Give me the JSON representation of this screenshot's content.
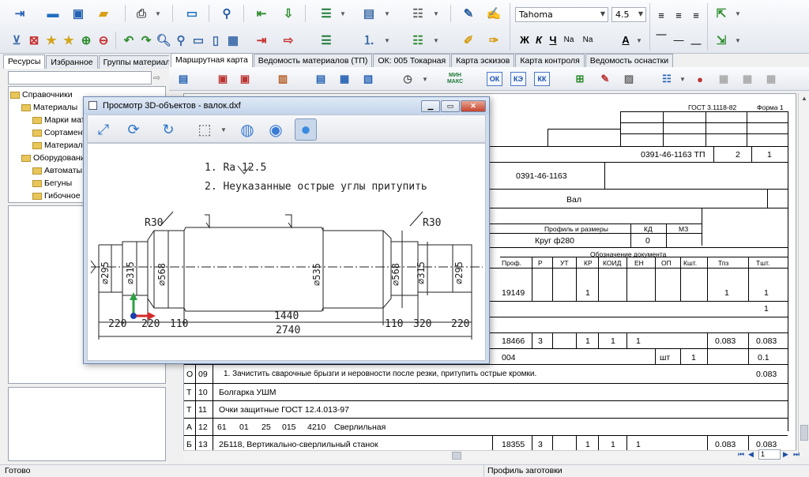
{
  "toolbar": {
    "font_name": "Tahoma",
    "font_size": "4.5",
    "bold": "Ж",
    "italic": "К",
    "underline": "Ч",
    "subscript": "Na",
    "superscript": "Na",
    "text_color_glyph": "A"
  },
  "left_panel": {
    "tabs": [
      "Ресурсы",
      "Избранное",
      "Группы материалов"
    ],
    "search_placeholder": "",
    "tree": [
      {
        "label": "Справочники",
        "level": 0
      },
      {
        "label": "Материалы",
        "level": 1
      },
      {
        "label": "Марки мате",
        "level": 2
      },
      {
        "label": "Сортамент",
        "level": 2
      },
      {
        "label": "Материалы",
        "level": 2
      },
      {
        "label": "Оборудование",
        "level": 1
      },
      {
        "label": "Автоматы",
        "level": 2
      },
      {
        "label": "Бегуны",
        "level": 2
      },
      {
        "label": "Гибочное",
        "level": 2
      }
    ]
  },
  "doc_tabs": [
    "Маршрутная карта",
    "Ведомость материалов (ТП)",
    "ОК: 005 Токарная",
    "Карта эскизов",
    "Карта контроля",
    "Ведомость оснастки"
  ],
  "doc_toolbar": {
    "ok": "ОК",
    "ke": "КЭ",
    "kk": "КК",
    "minmax": "МИН МАКС"
  },
  "document": {
    "gost": "ГОСТ 3.1118-82",
    "form": "Форма 1",
    "code1": "0391-46-1163 ТП",
    "sheets": "2",
    "sheet": "1",
    "code2": "0391-46-1163",
    "name": "Вал",
    "profile_header": "Профиль и размеры",
    "kd_header": "КД",
    "mz_header": "МЗ",
    "profile": "Круг ф280",
    "kd": "0",
    "designation_header": "Обозначение документа",
    "col_headers": [
      "Проф.",
      "Р",
      "УТ",
      "КР",
      "КОИД",
      "ЕН",
      "ОП",
      "Кшт.",
      "Тпз",
      "Тшт."
    ],
    "row_a": {
      "code": "19149",
      "kr": "1",
      "tpz": "1",
      "tsht": "1"
    },
    "row_b": {
      "tsht": "1"
    },
    "row_c": {
      "code": "18466",
      "r": "3",
      "kr": "1",
      "koid": "1",
      "en": "1",
      "tpz": "0.083",
      "tsht": "0.083"
    },
    "row_d": {
      "code": "004",
      "unit": "шт",
      "qty": "1",
      "tsht": "0.1"
    },
    "row_09": {
      "letter": "О",
      "num": "09",
      "text": "1.   Зачистить сварочные брызги и неровности после резки, притупить острые кромки.",
      "tsht": "0.083"
    },
    "row_10": {
      "letter": "Т",
      "num": "10",
      "text": "Болгарка УШМ"
    },
    "row_11": {
      "letter": "Т",
      "num": "11",
      "text": "Очки защитные ГОСТ 12.4.013-97"
    },
    "row_12": {
      "letter": "А",
      "num": "12",
      "c1": "61",
      "c2": "01",
      "c3": "25",
      "c4": "015",
      "c5": "4210",
      "text": "Сверлильная"
    },
    "row_13": {
      "letter": "Б",
      "num": "13",
      "text": "2Б118, Вертикально-сверлильный станок",
      "code": "18355",
      "r": "3",
      "kr": "1",
      "koid": "1",
      "en": "1",
      "tpz": "0.083",
      "tsht": "0.083"
    }
  },
  "pager": {
    "page": "1"
  },
  "popup": {
    "title": "Просмотр 3D-объектов - валок.dxf",
    "note1": "1. Ra 12.5",
    "note2": "2. Неуказанные острые углы притупить",
    "r_left": "R30",
    "r_right": "R30",
    "d295_l": "⌀295",
    "d315_l": "⌀315",
    "d568_l": "⌀568",
    "d535": "⌀535",
    "d568_r": "⌀568",
    "d315_r": "⌀315",
    "d295_r": "⌀295",
    "dim_220a": "220",
    "dim_220b": "220",
    "dim_110a": "110",
    "dim_1440": "1440",
    "dim_110b": "110",
    "dim_320": "320",
    "dim_220c": "220",
    "dim_2740": "2740"
  },
  "status": {
    "left": "Готово",
    "middle": "Профиль заготовки"
  }
}
